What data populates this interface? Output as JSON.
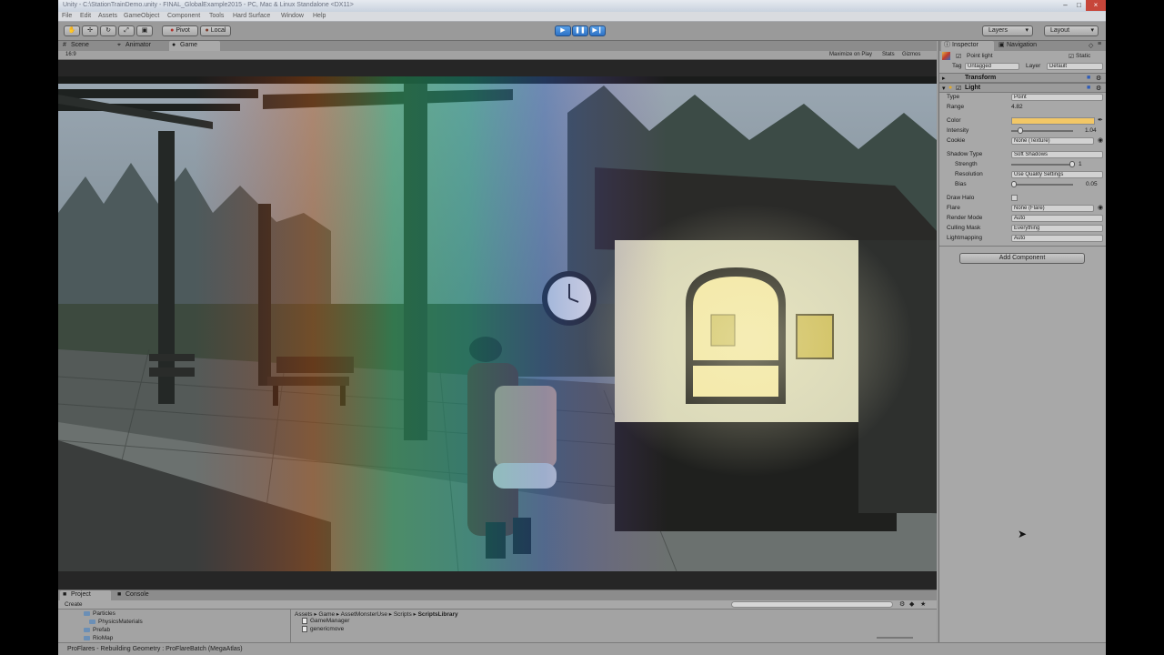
{
  "window": {
    "title": "Unity - C:\\StationTrainDemo.unity - FINAL_GlobalExample2015 - PC, Mac & Linux Standalone <DX11>"
  },
  "menu": [
    "File",
    "Edit",
    "Assets",
    "GameObject",
    "Component",
    "Tools",
    "Hard Surface",
    "Window",
    "Help"
  ],
  "toolbar": {
    "pivot": "Pivot",
    "local": "Local",
    "layers": "Layers",
    "layout": "Layout"
  },
  "tabs": {
    "scene": "Scene",
    "animator": "Animator",
    "game": "Game",
    "inspector": "Inspector",
    "navigation": "Navigation",
    "project": "Project",
    "console": "Console"
  },
  "gamebar": {
    "aspect": "16:9",
    "maximize": "Maximize on Play",
    "stats": "Stats",
    "gizmos": "Gizmos"
  },
  "inspector": {
    "object_name": "Point light",
    "static_label": "Static",
    "tag_label": "Tag",
    "tag_value": "Untagged",
    "layer_label": "Layer",
    "layer_value": "Default",
    "transform_header": "Transform",
    "light_header": "Light",
    "type": {
      "label": "Type",
      "value": "Point"
    },
    "range": {
      "label": "Range",
      "value": "4.82"
    },
    "color": {
      "label": "Color",
      "value": "#f2c766"
    },
    "intensity": {
      "label": "Intensity",
      "value": "1.04",
      "fraction": 0.13
    },
    "cookie": {
      "label": "Cookie",
      "value": "None (Texture)"
    },
    "shadow_type": {
      "label": "Shadow Type",
      "value": "Soft Shadows"
    },
    "strength": {
      "label": "Strength",
      "value": "1",
      "fraction": 1.0
    },
    "resolution": {
      "label": "Resolution",
      "value": "Use Quality Settings"
    },
    "bias": {
      "label": "Bias",
      "value": "0.05",
      "fraction": 0.0
    },
    "draw_halo": {
      "label": "Draw Halo",
      "checked": false
    },
    "flare": {
      "label": "Flare",
      "value": "None (Flare)"
    },
    "render_mode": {
      "label": "Render Mode",
      "value": "Auto"
    },
    "culling_mask": {
      "label": "Culling Mask",
      "value": "Everything"
    },
    "lightmapping": {
      "label": "Lightmapping",
      "value": "Auto"
    },
    "add_component": "Add Component"
  },
  "project": {
    "create": "Create",
    "folders": [
      "Particles",
      "PhysicsMaterials",
      "Prefab",
      "RioMap"
    ],
    "breadcrumb": [
      "Assets",
      "Game",
      "AssetMonsterUse",
      "Scripts",
      "ScriptsLibrary"
    ],
    "files": [
      "GameManager",
      "genericmove"
    ]
  },
  "status": {
    "message": "ProFlares - Rebuilding Geometry : ProFlareBatch (MegaAtlas)"
  }
}
